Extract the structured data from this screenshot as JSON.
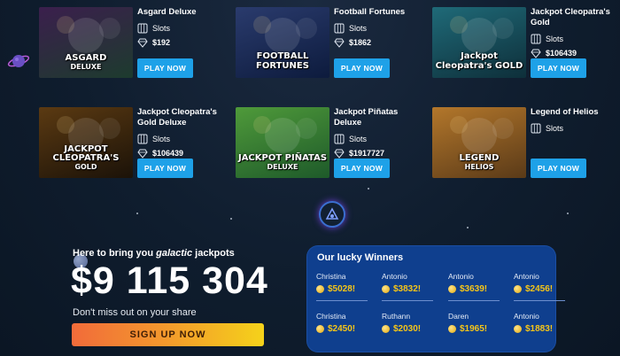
{
  "games": [
    {
      "name": "Asgard Deluxe",
      "category": "Slots",
      "jackpot": "$192",
      "play_label": "PLAY NOW",
      "thumb_text": "ASGARD",
      "thumb_sub": "DELUXE",
      "icon": "diamond-icon",
      "bg": [
        "#3b1f4d",
        "#1d3b2e"
      ]
    },
    {
      "name": "Football Fortunes",
      "category": "Slots",
      "jackpot": "$1862",
      "play_label": "PLAY NOW",
      "thumb_text": "FOOTBALL FORTUNES",
      "thumb_sub": "",
      "icon": "diamond-icon",
      "bg": [
        "#2a3b6d",
        "#0d1b3d"
      ]
    },
    {
      "name": "Jackpot Cleopatra's Gold",
      "category": "Slots",
      "jackpot": "$106439",
      "play_label": "PLAY NOW",
      "thumb_text": "Jackpot Cleopatra's GOLD",
      "thumb_sub": "",
      "icon": "diamond-icon",
      "bg": [
        "#1f6a78",
        "#0e2f3a"
      ]
    },
    {
      "name": "Jackpot Cleopatra's Gold Deluxe",
      "category": "Slots",
      "jackpot": "$106439",
      "play_label": "PLAY NOW",
      "thumb_text": "JACKPOT CLEOPATRA'S",
      "thumb_sub": "GOLD",
      "icon": "diamond-icon",
      "bg": [
        "#5b3a12",
        "#1b1208"
      ]
    },
    {
      "name": "Jackpot Piñatas Deluxe",
      "category": "Slots",
      "jackpot": "$1917727",
      "play_label": "PLAY NOW",
      "thumb_text": "JACKPOT PIÑATAS",
      "thumb_sub": "DELUXE",
      "icon": "diamond-icon",
      "bg": [
        "#4f9a3a",
        "#1e5a2a"
      ]
    },
    {
      "name": "Legend of Helios",
      "category": "Slots",
      "jackpot": "",
      "play_label": "PLAY NOW",
      "thumb_text": "LEGEND",
      "thumb_sub": "HELIOS",
      "icon": "",
      "bg": [
        "#b3772b",
        "#5a3a18"
      ]
    }
  ],
  "promo": {
    "tagline_prefix": "Here to bring you ",
    "tagline_emphasis": "galactic",
    "tagline_suffix": " jackpots",
    "amount": "$9 115 304",
    "subtext": "Don't miss out on your share",
    "signup_label": "SIGN UP NOW"
  },
  "winners": {
    "title": "Our lucky Winners",
    "items": [
      {
        "name": "Christina",
        "amount": "$5028!"
      },
      {
        "name": "Antonio",
        "amount": "$3832!"
      },
      {
        "name": "Antonio",
        "amount": "$3639!"
      },
      {
        "name": "Antonio",
        "amount": "$2456!"
      },
      {
        "name": "Christina",
        "amount": "$2450!"
      },
      {
        "name": "Ruthann",
        "amount": "$2030!"
      },
      {
        "name": "Daren",
        "amount": "$1965!"
      },
      {
        "name": "Antonio",
        "amount": "$1883!"
      }
    ]
  },
  "colors": {
    "accent": "#1ea1e8",
    "winners_bg": "#0f3f8e",
    "gold": "#f5c518"
  }
}
